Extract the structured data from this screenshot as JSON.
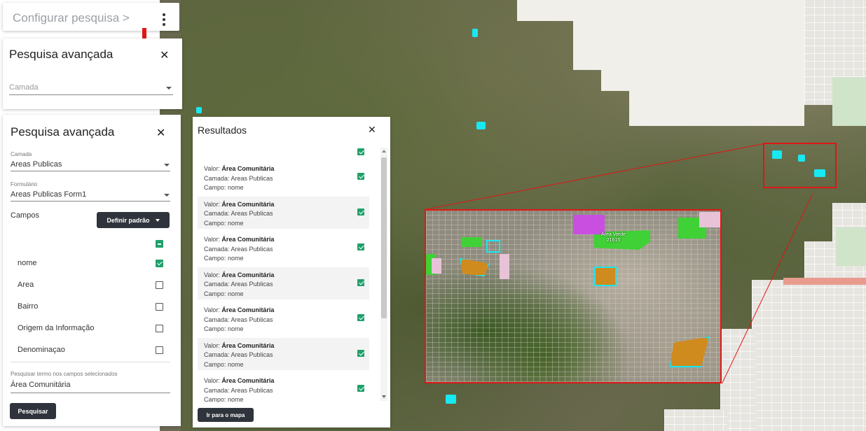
{
  "config_bar": {
    "title": "Configurar pesquisa >"
  },
  "panel_small": {
    "title": "Pesquisa avançada",
    "camada_placeholder": "Camada"
  },
  "panel_main": {
    "title": "Pesquisa avançada",
    "camada_label": "Camada",
    "camada_value": "Areas Publicas",
    "formulario_label": "Formulário",
    "formulario_value": "Areas Publicas Form1",
    "campos_label": "Campos",
    "definir_padrao": "Definir padrão",
    "fields": [
      {
        "label": "nome",
        "checked": true
      },
      {
        "label": "Area",
        "checked": false
      },
      {
        "label": "Bairro",
        "checked": false
      },
      {
        "label": "Origem da Informação",
        "checked": false
      },
      {
        "label": "Denominaçao",
        "checked": false
      }
    ],
    "search_label": "Pesquisar termo nos campos selecionados",
    "search_value": "Área Comunitária",
    "search_button": "Pesquisar"
  },
  "results": {
    "title": "Resultados",
    "valor_prefix": "Valor: ",
    "items": [
      {
        "valor": "Área Comunitária",
        "camada": "Camada: Areas Publicas",
        "campo": "Campo: nome"
      },
      {
        "valor": "Área Comunitária",
        "camada": "Camada: Areas Publicas",
        "campo": "Campo: nome"
      },
      {
        "valor": "Área Comunitária",
        "camada": "Camada: Areas Publicas",
        "campo": "Campo: nome"
      },
      {
        "valor": "Área Comunitária",
        "camada": "Camada: Areas Publicas",
        "campo": "Campo: nome"
      },
      {
        "valor": "Área Comunitária",
        "camada": "Camada: Areas Publicas",
        "campo": "Campo: nome"
      },
      {
        "valor": "Área Comunitária",
        "camada": "Camada: Areas Publicas",
        "campo": "Campo: nome"
      },
      {
        "valor": "Área Comunitária",
        "camada": "Camada: Areas Publicas",
        "campo": "Campo: nome"
      }
    ],
    "go_to_map": "Ir para o mapa"
  },
  "map": {
    "inset_label": "Área Verde\n21615"
  },
  "colors": {
    "highlight": "#18e8f2",
    "zoom_frame": "#e01616",
    "checkbox": "#21a06b",
    "button_dark": "#2f333b"
  }
}
